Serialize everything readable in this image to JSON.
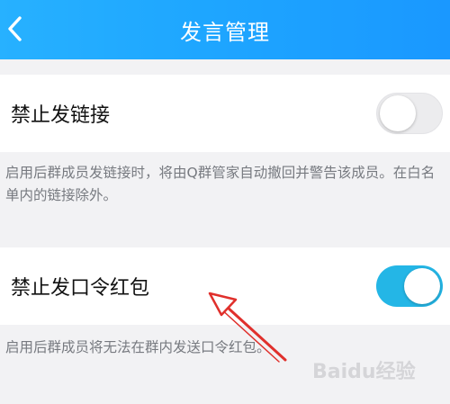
{
  "header": {
    "title": "发言管理",
    "back_icon": "chevron-left-icon",
    "gradient_start": "#27b1ff",
    "gradient_end": "#1a98ff"
  },
  "settings": [
    {
      "label": "禁止发链接",
      "enabled": false,
      "description": "启用后群成员发链接时，将由Q群管家自动撤回并警告该成员。在白名单内的链接除外。"
    },
    {
      "label": "禁止发口令红包",
      "enabled": true,
      "description": "启用后群成员将无法在群内发送口令红包。"
    }
  ],
  "colors": {
    "toggle_on": "#24b6e6",
    "toggle_off": "#ececee",
    "annotation_arrow": "#e0302c"
  },
  "watermark": {
    "text": "Baidu经验"
  }
}
